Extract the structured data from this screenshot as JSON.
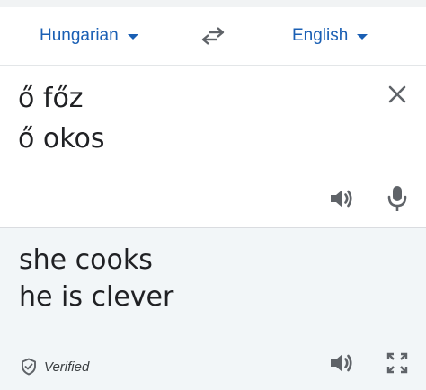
{
  "language_bar": {
    "source_language": "Hungarian",
    "target_language": "English",
    "swap_icon": "swap-arrows-icon"
  },
  "source": {
    "text": "ő főz\nő okos",
    "clear_icon": "close-icon",
    "speaker_icon": "speaker-icon",
    "mic_icon": "microphone-icon"
  },
  "translation": {
    "text": "she cooks\nhe is clever",
    "verified_label": "Verified",
    "verified_icon": "shield-check-icon",
    "speaker_icon": "speaker-icon",
    "fullscreen_icon": "fullscreen-icon"
  },
  "colors": {
    "accent": "#1a5fb4",
    "icon_gray": "#5f6368",
    "translation_bg": "#f2f6f8"
  }
}
